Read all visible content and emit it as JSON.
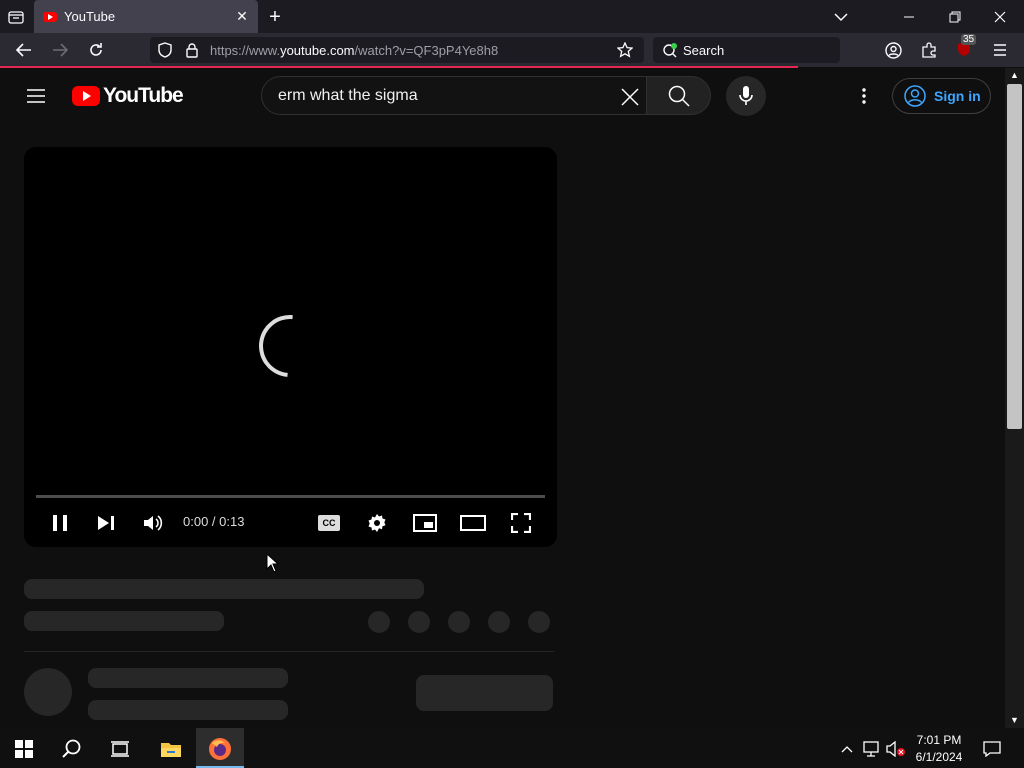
{
  "browser": {
    "tab_title": "YouTube",
    "url_prefix": "https://www.",
    "url_domain": "youtube.com",
    "url_path": "/watch?v=QF3pP4Ye8h8",
    "search_label": "Search",
    "extension_badge": "35",
    "accent_color": "#e22850"
  },
  "youtube": {
    "logo_text": "YouTube",
    "search_value": "erm what the sigma",
    "sign_in_label": "Sign in",
    "brand_color": "#ff0000",
    "link_color": "#3ea6ff"
  },
  "player": {
    "time_display": "0:00 / 0:13",
    "cc_label": "CC",
    "state": "loading"
  },
  "taskbar": {
    "time": "7:01 PM",
    "date": "6/1/2024"
  }
}
